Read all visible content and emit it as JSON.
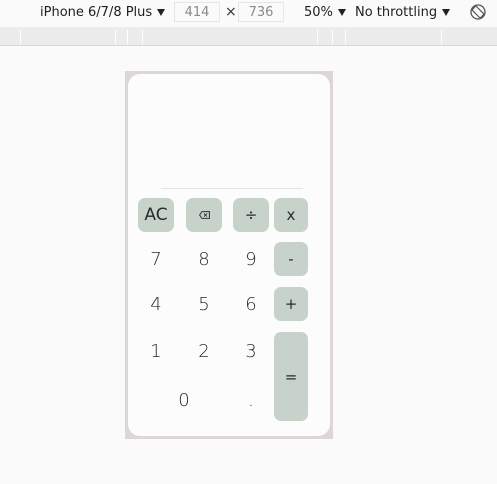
{
  "devtools": {
    "device": "iPhone 6/7/8 Plus",
    "width": "414",
    "height": "736",
    "times_sign": "×",
    "zoom": "50%",
    "throttling": "No throttling"
  },
  "calculator": {
    "display": "",
    "keys": {
      "ac": "AC",
      "divide": "÷",
      "multiply": "x",
      "minus": "-",
      "plus": "+",
      "equals": "=",
      "seven": "7",
      "eight": "8",
      "nine": "9",
      "four": "4",
      "five": "5",
      "six": "6",
      "one": "1",
      "two": "2",
      "three": "3",
      "zero": "0",
      "decimal": "."
    },
    "colors": {
      "operator_key": "#c7d3ca",
      "frame": "#ddd6d6",
      "surface": "#fcfcfc"
    }
  }
}
